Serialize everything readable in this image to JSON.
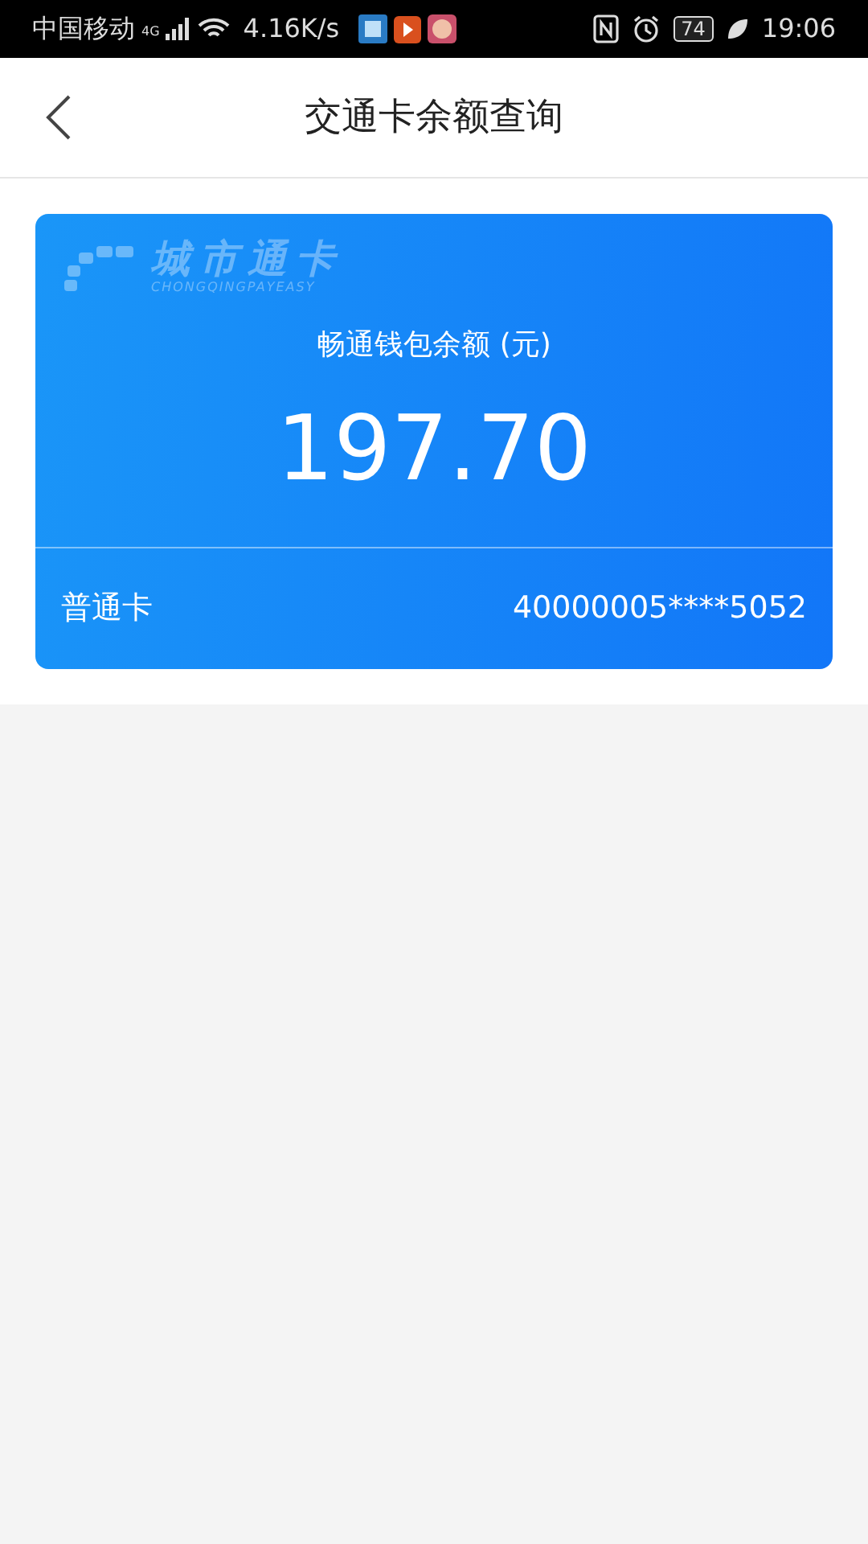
{
  "status_bar": {
    "carrier": "中国移动",
    "network": "4G",
    "speed": "4.16K/s",
    "battery": "74",
    "time": "19:06"
  },
  "header": {
    "title": "交通卡余额查询"
  },
  "card": {
    "logo_title": "城市通卡",
    "logo_subtitle": "CHONGQINGPAYEASY",
    "balance_label": "畅通钱包余额 (元)",
    "balance": "197.70",
    "card_type": "普通卡",
    "card_number": "40000005****5052"
  }
}
